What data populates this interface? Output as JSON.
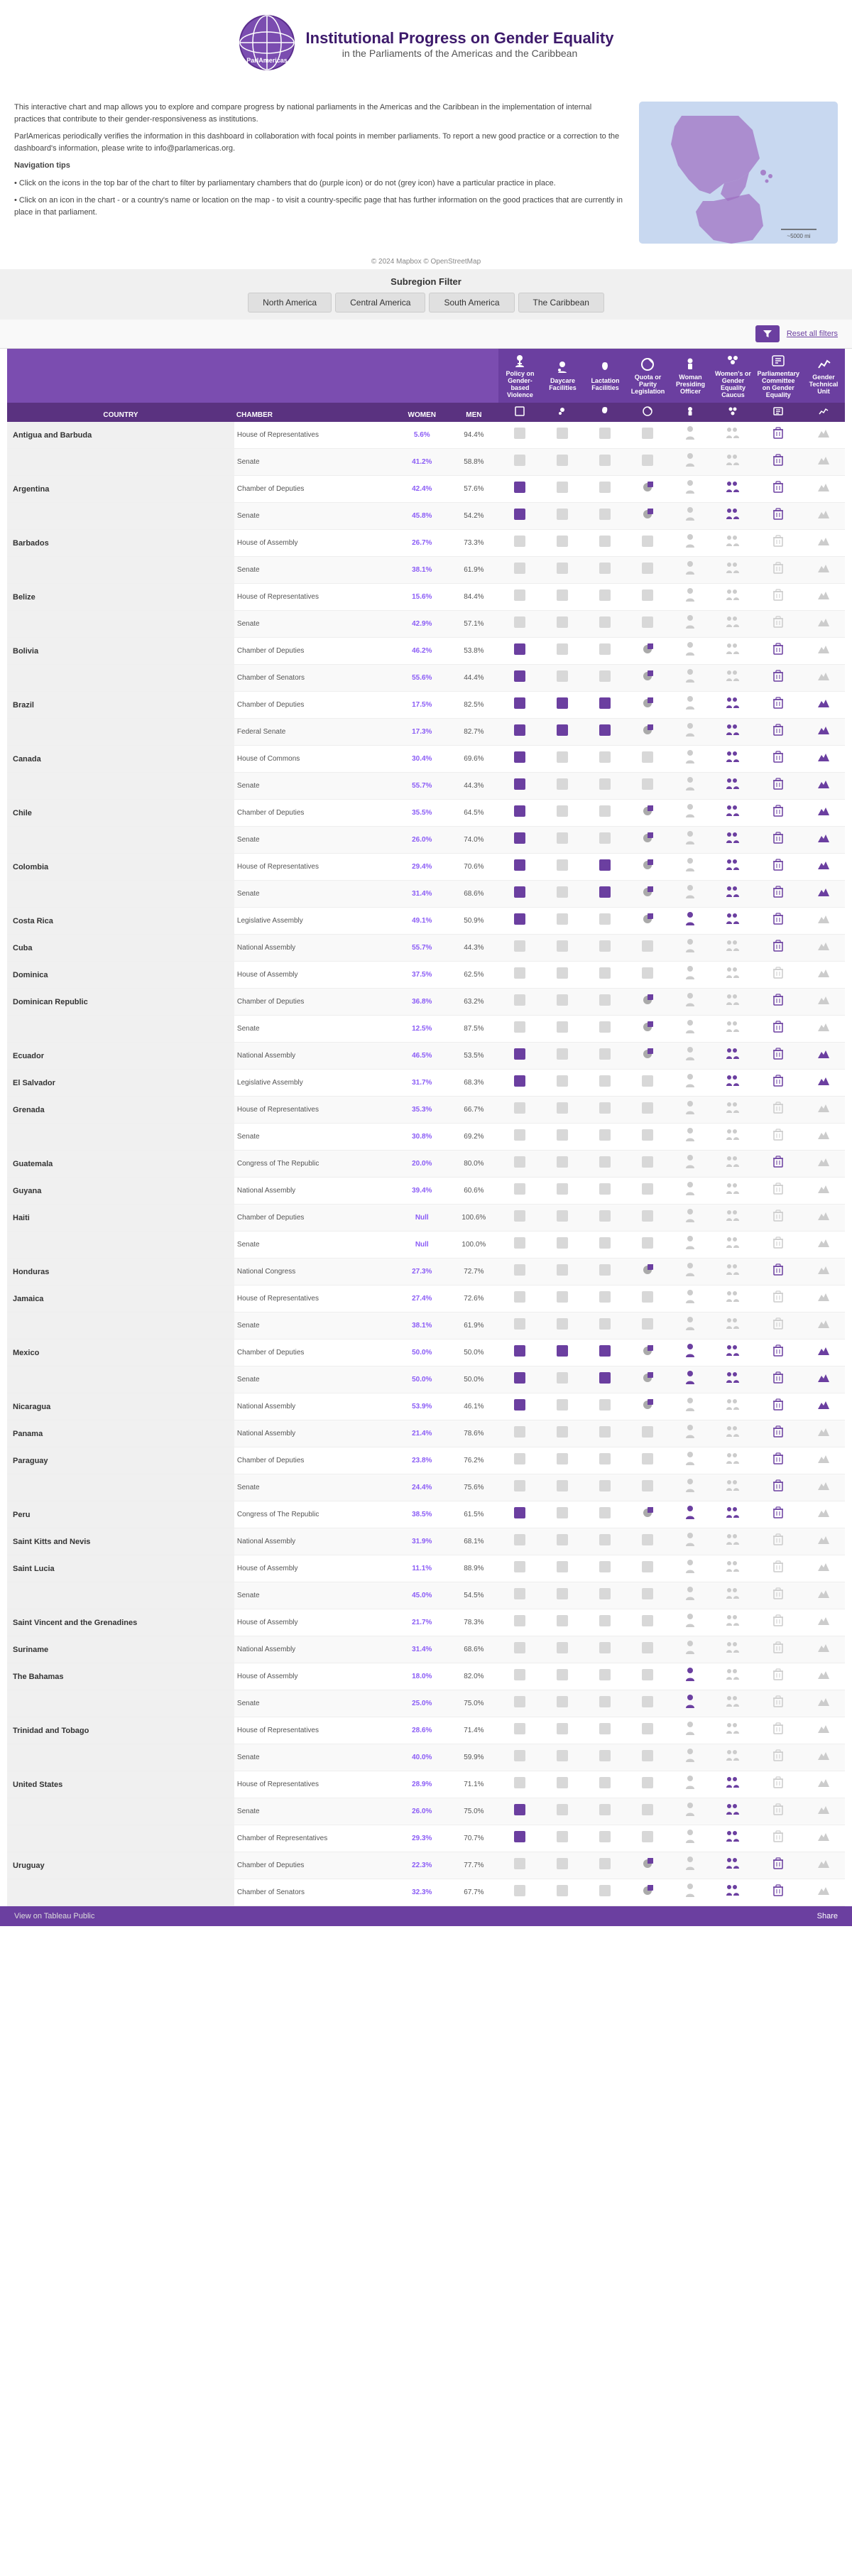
{
  "header": {
    "logo_text": "ParlAmericas",
    "title": "Institutional Progress on Gender Equality",
    "subtitle": "in the Parliaments of the Americas and the Caribbean"
  },
  "info": {
    "paragraph1": "This interactive chart and map allows you to explore and compare progress by national parliaments in the Americas and the Caribbean in the implementation of internal practices that contribute to their gender-responsiveness as institutions.",
    "paragraph2": "ParlAmericas periodically verifies the information in this dashboard in collaboration with focal points in member parliaments. To report a new good practice or a correction to the dashboard's information, please write to info@parlamericas.org.",
    "nav_title": "Navigation tips",
    "nav_tip1": "• Click on the icons in the top bar of the chart to filter by parliamentary chambers that do (purple icon) or do not (grey icon) have a particular practice in place.",
    "nav_tip2": "• Click on an icon in the chart - or a country's name or location on the map - to visit a country-specific page that has further information on the good practices that are currently in place in that parliament."
  },
  "copyright": "© 2024 Mapbox © OpenStreetMap",
  "map_scale": "~5000 mi",
  "subregion": {
    "label": "Subregion Filter",
    "tabs": [
      "North America",
      "Central America",
      "South America",
      "The Caribbean"
    ]
  },
  "filter": {
    "reset_label": "Reset all filters"
  },
  "columns": {
    "country": "COUNTRY",
    "chamber": "CHAMBER",
    "women": "WOMEN",
    "men": "MEN",
    "col1": "Policy on Gender-based Violence",
    "col2": "Daycare Facilities",
    "col3": "Lactation Facilities",
    "col4": "Quota or Parity Legislation",
    "col5": "Woman Presiding Officer",
    "col6": "Women's or Gender Equality Caucus",
    "col7": "Parliamentary Committee on Gender Equality",
    "col8": "Gender Technical Unit"
  },
  "rows": [
    {
      "country": "Antigua and Barbuda",
      "chamber": "House of Representatives",
      "women": "5.6%",
      "men": "94.4%",
      "c1": 0,
      "c2": 0,
      "c3": 0,
      "c4": 0,
      "c5": 0,
      "c6": 0,
      "c7": 1,
      "c8": 0
    },
    {
      "country": "",
      "chamber": "Senate",
      "women": "41.2%",
      "men": "58.8%",
      "c1": 0,
      "c2": 0,
      "c3": 0,
      "c4": 0,
      "c5": 0,
      "c6": 0,
      "c7": 1,
      "c8": 0
    },
    {
      "country": "Argentina",
      "chamber": "Chamber of Deputies",
      "women": "42.4%",
      "men": "57.6%",
      "c1": 1,
      "c2": 0,
      "c3": 0,
      "c4": 2,
      "c5": 0,
      "c6": 1,
      "c7": 1,
      "c8": 0
    },
    {
      "country": "",
      "chamber": "Senate",
      "women": "45.8%",
      "men": "54.2%",
      "c1": 1,
      "c2": 0,
      "c3": 0,
      "c4": 2,
      "c5": 0,
      "c6": 1,
      "c7": 1,
      "c8": 0
    },
    {
      "country": "Barbados",
      "chamber": "House of Assembly",
      "women": "26.7%",
      "men": "73.3%",
      "c1": 0,
      "c2": 0,
      "c3": 0,
      "c4": 0,
      "c5": 0,
      "c6": 0,
      "c7": 0,
      "c8": 0
    },
    {
      "country": "",
      "chamber": "Senate",
      "women": "38.1%",
      "men": "61.9%",
      "c1": 0,
      "c2": 0,
      "c3": 0,
      "c4": 0,
      "c5": 0,
      "c6": 0,
      "c7": 0,
      "c8": 0
    },
    {
      "country": "Belize",
      "chamber": "House of Representatives",
      "women": "15.6%",
      "men": "84.4%",
      "c1": 0,
      "c2": 0,
      "c3": 0,
      "c4": 0,
      "c5": 0,
      "c6": 0,
      "c7": 0,
      "c8": 0
    },
    {
      "country": "",
      "chamber": "Senate",
      "women": "42.9%",
      "men": "57.1%",
      "c1": 0,
      "c2": 0,
      "c3": 0,
      "c4": 0,
      "c5": 0,
      "c6": 0,
      "c7": 0,
      "c8": 0
    },
    {
      "country": "Bolivia",
      "chamber": "Chamber of Deputies",
      "women": "46.2%",
      "men": "53.8%",
      "c1": 1,
      "c2": 0,
      "c3": 0,
      "c4": 2,
      "c5": 0,
      "c6": 0,
      "c7": 1,
      "c8": 0
    },
    {
      "country": "",
      "chamber": "Chamber of Senators",
      "women": "55.6%",
      "men": "44.4%",
      "c1": 1,
      "c2": 0,
      "c3": 0,
      "c4": 2,
      "c5": 0,
      "c6": 0,
      "c7": 1,
      "c8": 0
    },
    {
      "country": "Brazil",
      "chamber": "Chamber of Deputies",
      "women": "17.5%",
      "men": "82.5%",
      "c1": 1,
      "c2": 1,
      "c3": 1,
      "c4": 2,
      "c5": 0,
      "c6": 1,
      "c7": 1,
      "c8": 1
    },
    {
      "country": "",
      "chamber": "Federal Senate",
      "women": "17.3%",
      "men": "82.7%",
      "c1": 1,
      "c2": 1,
      "c3": 1,
      "c4": 2,
      "c5": 0,
      "c6": 1,
      "c7": 1,
      "c8": 1
    },
    {
      "country": "Canada",
      "chamber": "House of Commons",
      "women": "30.4%",
      "men": "69.6%",
      "c1": 1,
      "c2": 0,
      "c3": 0,
      "c4": 0,
      "c5": 0,
      "c6": 1,
      "c7": 1,
      "c8": 1
    },
    {
      "country": "",
      "chamber": "Senate",
      "women": "55.7%",
      "men": "44.3%",
      "c1": 1,
      "c2": 0,
      "c3": 0,
      "c4": 0,
      "c5": 0,
      "c6": 1,
      "c7": 1,
      "c8": 1
    },
    {
      "country": "Chile",
      "chamber": "Chamber of Deputies",
      "women": "35.5%",
      "men": "64.5%",
      "c1": 1,
      "c2": 0,
      "c3": 0,
      "c4": 2,
      "c5": 0,
      "c6": 1,
      "c7": 1,
      "c8": 1
    },
    {
      "country": "",
      "chamber": "Senate",
      "women": "26.0%",
      "men": "74.0%",
      "c1": 1,
      "c2": 0,
      "c3": 0,
      "c4": 2,
      "c5": 0,
      "c6": 1,
      "c7": 1,
      "c8": 1
    },
    {
      "country": "Colombia",
      "chamber": "House of Representatives",
      "women": "29.4%",
      "men": "70.6%",
      "c1": 1,
      "c2": 0,
      "c3": 1,
      "c4": 2,
      "c5": 0,
      "c6": 1,
      "c7": 1,
      "c8": 1
    },
    {
      "country": "",
      "chamber": "Senate",
      "women": "31.4%",
      "men": "68.6%",
      "c1": 1,
      "c2": 0,
      "c3": 1,
      "c4": 2,
      "c5": 0,
      "c6": 1,
      "c7": 1,
      "c8": 1
    },
    {
      "country": "Costa Rica",
      "chamber": "Legislative Assembly",
      "women": "49.1%",
      "men": "50.9%",
      "c1": 1,
      "c2": 0,
      "c3": 0,
      "c4": 2,
      "c5": 1,
      "c6": 1,
      "c7": 1,
      "c8": 0
    },
    {
      "country": "Cuba",
      "chamber": "National Assembly",
      "women": "55.7%",
      "men": "44.3%",
      "c1": 0,
      "c2": 0,
      "c3": 0,
      "c4": 0,
      "c5": 0,
      "c6": 0,
      "c7": 1,
      "c8": 0
    },
    {
      "country": "Dominica",
      "chamber": "House of Assembly",
      "women": "37.5%",
      "men": "62.5%",
      "c1": 0,
      "c2": 0,
      "c3": 0,
      "c4": 0,
      "c5": 0,
      "c6": 0,
      "c7": 0,
      "c8": 0
    },
    {
      "country": "Dominican Republic",
      "chamber": "Chamber of Deputies",
      "women": "36.8%",
      "men": "63.2%",
      "c1": 0,
      "c2": 0,
      "c3": 0,
      "c4": 2,
      "c5": 0,
      "c6": 0,
      "c7": 1,
      "c8": 0
    },
    {
      "country": "",
      "chamber": "Senate",
      "women": "12.5%",
      "men": "87.5%",
      "c1": 0,
      "c2": 0,
      "c3": 0,
      "c4": 2,
      "c5": 0,
      "c6": 0,
      "c7": 1,
      "c8": 0
    },
    {
      "country": "Ecuador",
      "chamber": "National Assembly",
      "women": "46.5%",
      "men": "53.5%",
      "c1": 1,
      "c2": 0,
      "c3": 0,
      "c4": 2,
      "c5": 0,
      "c6": 1,
      "c7": 1,
      "c8": 1
    },
    {
      "country": "El Salvador",
      "chamber": "Legislative Assembly",
      "women": "31.7%",
      "men": "68.3%",
      "c1": 1,
      "c2": 0,
      "c3": 0,
      "c4": 0,
      "c5": 0,
      "c6": 1,
      "c7": 1,
      "c8": 1
    },
    {
      "country": "Grenada",
      "chamber": "House of Representatives",
      "women": "35.3%",
      "men": "66.7%",
      "c1": 0,
      "c2": 0,
      "c3": 0,
      "c4": 0,
      "c5": 0,
      "c6": 0,
      "c7": 0,
      "c8": 0
    },
    {
      "country": "",
      "chamber": "Senate",
      "women": "30.8%",
      "men": "69.2%",
      "c1": 0,
      "c2": 0,
      "c3": 0,
      "c4": 0,
      "c5": 0,
      "c6": 0,
      "c7": 0,
      "c8": 0
    },
    {
      "country": "Guatemala",
      "chamber": "Congress of The Republic",
      "women": "20.0%",
      "men": "80.0%",
      "c1": 0,
      "c2": 0,
      "c3": 0,
      "c4": 0,
      "c5": 0,
      "c6": 0,
      "c7": 1,
      "c8": 0
    },
    {
      "country": "Guyana",
      "chamber": "National Assembly",
      "women": "39.4%",
      "men": "60.6%",
      "c1": 0,
      "c2": 0,
      "c3": 0,
      "c4": 0,
      "c5": 0,
      "c6": 0,
      "c7": 0,
      "c8": 0
    },
    {
      "country": "Haiti",
      "chamber": "Chamber of Deputies",
      "women": "Null",
      "men": "100.6%",
      "c1": 0,
      "c2": 0,
      "c3": 0,
      "c4": 0,
      "c5": 0,
      "c6": 0,
      "c7": 0,
      "c8": 0
    },
    {
      "country": "",
      "chamber": "Senate",
      "women": "Null",
      "men": "100.0%",
      "c1": 0,
      "c2": 0,
      "c3": 0,
      "c4": 0,
      "c5": 0,
      "c6": 0,
      "c7": 0,
      "c8": 0
    },
    {
      "country": "Honduras",
      "chamber": "National Congress",
      "women": "27.3%",
      "men": "72.7%",
      "c1": 0,
      "c2": 0,
      "c3": 0,
      "c4": 2,
      "c5": 0,
      "c6": 0,
      "c7": 1,
      "c8": 0
    },
    {
      "country": "Jamaica",
      "chamber": "House of Representatives",
      "women": "27.4%",
      "men": "72.6%",
      "c1": 0,
      "c2": 0,
      "c3": 0,
      "c4": 0,
      "c5": 0,
      "c6": 0,
      "c7": 0,
      "c8": 0
    },
    {
      "country": "",
      "chamber": "Senate",
      "women": "38.1%",
      "men": "61.9%",
      "c1": 0,
      "c2": 0,
      "c3": 0,
      "c4": 0,
      "c5": 0,
      "c6": 0,
      "c7": 0,
      "c8": 0
    },
    {
      "country": "Mexico",
      "chamber": "Chamber of Deputies",
      "women": "50.0%",
      "men": "50.0%",
      "c1": 1,
      "c2": 1,
      "c3": 1,
      "c4": 2,
      "c5": 1,
      "c6": 1,
      "c7": 1,
      "c8": 1
    },
    {
      "country": "",
      "chamber": "Senate",
      "women": "50.0%",
      "men": "50.0%",
      "c1": 1,
      "c2": 0,
      "c3": 1,
      "c4": 2,
      "c5": 1,
      "c6": 1,
      "c7": 1,
      "c8": 1
    },
    {
      "country": "Nicaragua",
      "chamber": "National Assembly",
      "women": "53.9%",
      "men": "46.1%",
      "c1": 1,
      "c2": 0,
      "c3": 0,
      "c4": 2,
      "c5": 0,
      "c6": 0,
      "c7": 1,
      "c8": 1
    },
    {
      "country": "Panama",
      "chamber": "National Assembly",
      "women": "21.4%",
      "men": "78.6%",
      "c1": 0,
      "c2": 0,
      "c3": 0,
      "c4": 0,
      "c5": 0,
      "c6": 0,
      "c7": 1,
      "c8": 0
    },
    {
      "country": "Paraguay",
      "chamber": "Chamber of Deputies",
      "women": "23.8%",
      "men": "76.2%",
      "c1": 0,
      "c2": 0,
      "c3": 0,
      "c4": 0,
      "c5": 0,
      "c6": 0,
      "c7": 1,
      "c8": 0
    },
    {
      "country": "",
      "chamber": "Senate",
      "women": "24.4%",
      "men": "75.6%",
      "c1": 0,
      "c2": 0,
      "c3": 0,
      "c4": 0,
      "c5": 0,
      "c6": 0,
      "c7": 1,
      "c8": 0
    },
    {
      "country": "Peru",
      "chamber": "Congress of The Republic",
      "women": "38.5%",
      "men": "61.5%",
      "c1": 1,
      "c2": 0,
      "c3": 0,
      "c4": 2,
      "c5": 1,
      "c6": 1,
      "c7": 1,
      "c8": 0
    },
    {
      "country": "Saint Kitts and Nevis",
      "chamber": "National Assembly",
      "women": "31.9%",
      "men": "68.1%",
      "c1": 0,
      "c2": 0,
      "c3": 0,
      "c4": 0,
      "c5": 0,
      "c6": 0,
      "c7": 0,
      "c8": 0
    },
    {
      "country": "Saint Lucia",
      "chamber": "House of Assembly",
      "women": "11.1%",
      "men": "88.9%",
      "c1": 0,
      "c2": 0,
      "c3": 0,
      "c4": 0,
      "c5": 0,
      "c6": 0,
      "c7": 0,
      "c8": 0
    },
    {
      "country": "",
      "chamber": "Senate",
      "women": "45.0%",
      "men": "54.5%",
      "c1": 0,
      "c2": 0,
      "c3": 0,
      "c4": 0,
      "c5": 0,
      "c6": 0,
      "c7": 0,
      "c8": 0
    },
    {
      "country": "Saint Vincent and the Grenadines",
      "chamber": "House of Assembly",
      "women": "21.7%",
      "men": "78.3%",
      "c1": 0,
      "c2": 0,
      "c3": 0,
      "c4": 0,
      "c5": 0,
      "c6": 0,
      "c7": 0,
      "c8": 0
    },
    {
      "country": "Suriname",
      "chamber": "National Assembly",
      "women": "31.4%",
      "men": "68.6%",
      "c1": 0,
      "c2": 0,
      "c3": 0,
      "c4": 0,
      "c5": 0,
      "c6": 0,
      "c7": 0,
      "c8": 0
    },
    {
      "country": "The Bahamas",
      "chamber": "House of Assembly",
      "women": "18.0%",
      "men": "82.0%",
      "c1": 0,
      "c2": 0,
      "c3": 0,
      "c4": 0,
      "c5": 1,
      "c6": 0,
      "c7": 0,
      "c8": 0
    },
    {
      "country": "",
      "chamber": "Senate",
      "women": "25.0%",
      "men": "75.0%",
      "c1": 0,
      "c2": 0,
      "c3": 0,
      "c4": 0,
      "c5": 1,
      "c6": 0,
      "c7": 0,
      "c8": 0
    },
    {
      "country": "Trinidad and Tobago",
      "chamber": "House of Representatives",
      "women": "28.6%",
      "men": "71.4%",
      "c1": 0,
      "c2": 0,
      "c3": 0,
      "c4": 0,
      "c5": 0,
      "c6": 0,
      "c7": 0,
      "c8": 0
    },
    {
      "country": "",
      "chamber": "Senate",
      "women": "40.0%",
      "men": "59.9%",
      "c1": 0,
      "c2": 0,
      "c3": 0,
      "c4": 0,
      "c5": 0,
      "c6": 0,
      "c7": 0,
      "c8": 0
    },
    {
      "country": "United States",
      "chamber": "House of Representatives",
      "women": "28.9%",
      "men": "71.1%",
      "c1": 0,
      "c2": 0,
      "c3": 0,
      "c4": 0,
      "c5": 0,
      "c6": 1,
      "c7": 0,
      "c8": 0
    },
    {
      "country": "",
      "chamber": "Senate",
      "women": "26.0%",
      "men": "75.0%",
      "c1": 1,
      "c2": 0,
      "c3": 0,
      "c4": 0,
      "c5": 0,
      "c6": 1,
      "c7": 0,
      "c8": 0
    },
    {
      "country": "",
      "chamber": "Chamber of Representatives",
      "women": "29.3%",
      "men": "70.7%",
      "c1": 1,
      "c2": 0,
      "c3": 0,
      "c4": 0,
      "c5": 0,
      "c6": 1,
      "c7": 0,
      "c8": 0
    },
    {
      "country": "Uruguay",
      "chamber": "Chamber of Deputies",
      "women": "22.3%",
      "men": "77.7%",
      "c1": 0,
      "c2": 0,
      "c3": 0,
      "c4": 2,
      "c5": 0,
      "c6": 1,
      "c7": 1,
      "c8": 0
    },
    {
      "country": "",
      "chamber": "Chamber of Senators",
      "women": "32.3%",
      "men": "67.7%",
      "c1": 0,
      "c2": 0,
      "c3": 0,
      "c4": 2,
      "c5": 0,
      "c6": 1,
      "c7": 1,
      "c8": 0
    }
  ],
  "footer": {
    "tableau_link": "View on Tableau Public",
    "share_label": "Share"
  }
}
